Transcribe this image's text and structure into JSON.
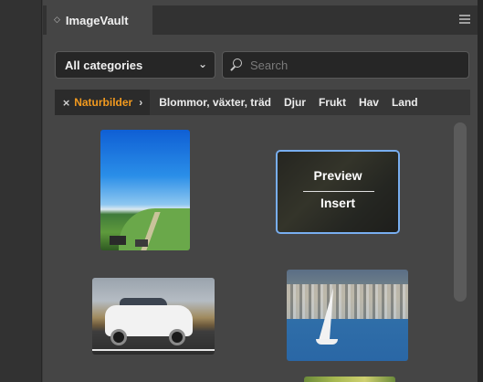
{
  "panel": {
    "title": "ImageVault"
  },
  "filters": {
    "category_value": "All categories",
    "search_placeholder": "Search"
  },
  "breadcrumbs": {
    "active": "Naturbilder",
    "items": [
      "Blommor, växter, träd",
      "Djur",
      "Frukt",
      "Hav",
      "Land"
    ]
  },
  "thumbnail_overlay": {
    "preview_label": "Preview",
    "insert_label": "Insert"
  },
  "colors": {
    "accent_orange": "#f29a1f",
    "selection_blue": "#78aef0"
  },
  "icons": [
    "chevron-down-icon",
    "search-icon",
    "close-icon",
    "panel-menu-icon"
  ]
}
